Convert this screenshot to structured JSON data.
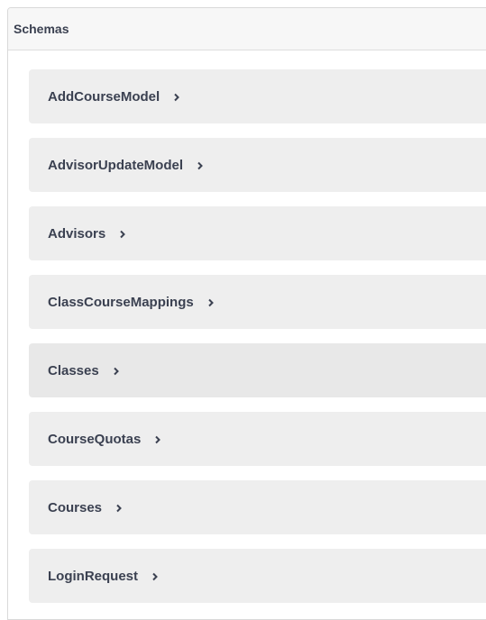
{
  "panel": {
    "title": "Schemas"
  },
  "schemas": [
    {
      "name": "AddCourseModel",
      "icon": "chevron-right-icon"
    },
    {
      "name": "AdvisorUpdateModel",
      "icon": "chevron-right-icon"
    },
    {
      "name": "Advisors",
      "icon": "chevron-right-icon"
    },
    {
      "name": "ClassCourseMappings",
      "icon": "chevron-right-icon"
    },
    {
      "name": "Classes",
      "icon": "chevron-right-icon"
    },
    {
      "name": "CourseQuotas",
      "icon": "chevron-right-icon"
    },
    {
      "name": "Courses",
      "icon": "chevron-right-icon"
    },
    {
      "name": "LoginRequest",
      "icon": "chevron-right-icon"
    }
  ],
  "colors": {
    "item_background": "#eeeeee",
    "item_highlight_background": "#e8e8e8",
    "text": "#3b4151",
    "header_background": "#f7f7f7",
    "border": "#d9d9d9"
  }
}
